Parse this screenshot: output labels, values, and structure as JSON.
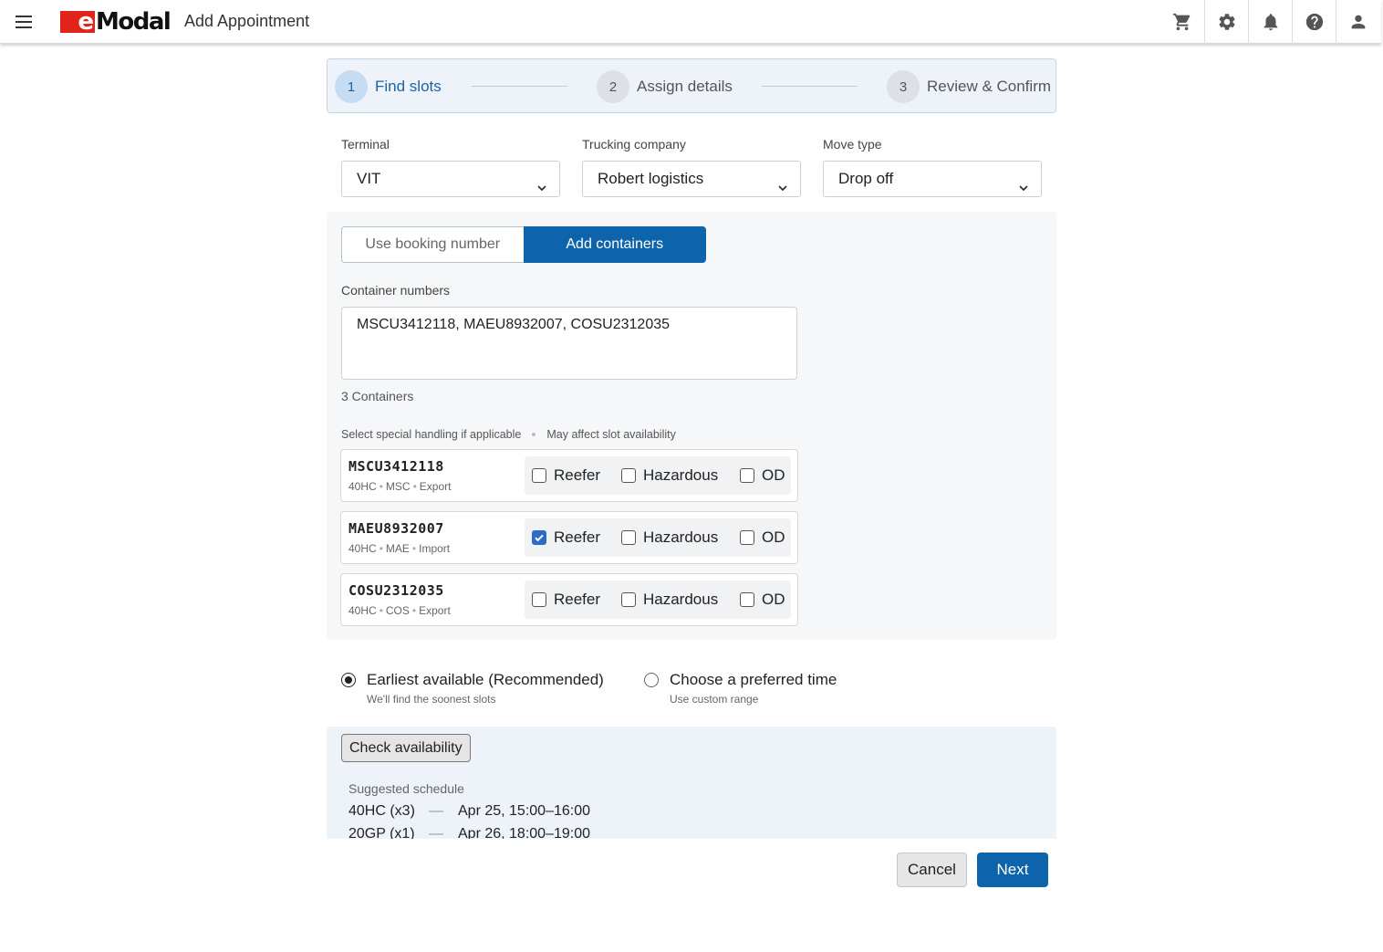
{
  "header": {
    "logo_e": "e",
    "logo_rest": "Modal",
    "title": "Add Appointment",
    "icons": [
      "cart-icon",
      "gear-icon",
      "bell-icon",
      "help-icon",
      "user-icon"
    ]
  },
  "stepper": {
    "steps": [
      {
        "num": "1",
        "label": "Find slots",
        "active": true
      },
      {
        "num": "2",
        "label": "Assign details",
        "active": false
      },
      {
        "num": "3",
        "label": "Review & Confirm",
        "active": false
      }
    ]
  },
  "fields": {
    "terminal": {
      "label": "Terminal",
      "value": "VIT"
    },
    "trucking": {
      "label": "Trucking company",
      "value": "Robert logistics"
    },
    "move_type": {
      "label": "Move type",
      "value": "Drop off"
    }
  },
  "toggle": {
    "booking": "Use booking number",
    "containers": "Add containers",
    "selected": "containers"
  },
  "containers": {
    "label": "Container numbers",
    "value": "MSCU3412118, MAEU8932007, COSU2312035",
    "count": "3 Containers",
    "hint_left": "Select special handling if applicable",
    "hint_right": "May affect slot availability",
    "option_labels": {
      "reefer": "Reefer",
      "hazardous": "Hazardous",
      "od": "OD"
    },
    "rows": [
      {
        "number": "MSCU3412118",
        "size": "40HC",
        "line": "MSC",
        "direction": "Export",
        "reefer": false,
        "hazardous": false,
        "od": false
      },
      {
        "number": "MAEU8932007",
        "size": "40HC",
        "line": "MAE",
        "direction": "Import",
        "reefer": true,
        "hazardous": false,
        "od": false
      },
      {
        "number": "COSU2312035",
        "size": "40HC",
        "line": "COS",
        "direction": "Export",
        "reefer": false,
        "hazardous": false,
        "od": false
      }
    ]
  },
  "timing": {
    "earliest": {
      "title": "Earliest available (Recommended)",
      "sub": "We'll find the soonest slots",
      "selected": true
    },
    "preferred": {
      "title": "Choose a preferred time",
      "sub": "Use custom range",
      "selected": false
    }
  },
  "availability": {
    "button": "Check availability",
    "title": "Suggested schedule",
    "rows": [
      {
        "type": "40HC (x3)",
        "dash": "—",
        "time": "Apr 25, 15:00–16:00"
      },
      {
        "type": "20GP (x1)",
        "dash": "—",
        "time": "Apr 26, 18:00–19:00"
      }
    ]
  },
  "footer": {
    "cancel": "Cancel",
    "next": "Next"
  },
  "colors": {
    "primary": "#0d64aa",
    "brand_red": "#e2231a",
    "checkbox_checked": "#2e6bc4"
  }
}
